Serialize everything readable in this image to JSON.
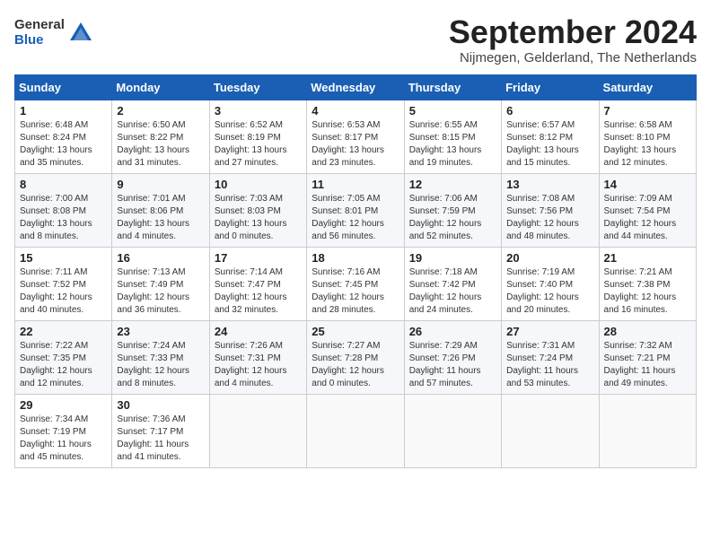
{
  "logo": {
    "general": "General",
    "blue": "Blue"
  },
  "title": "September 2024",
  "subtitle": "Nijmegen, Gelderland, The Netherlands",
  "headers": [
    "Sunday",
    "Monday",
    "Tuesday",
    "Wednesday",
    "Thursday",
    "Friday",
    "Saturday"
  ],
  "weeks": [
    [
      {
        "day": "1",
        "info": "Sunrise: 6:48 AM\nSunset: 8:24 PM\nDaylight: 13 hours\nand 35 minutes."
      },
      {
        "day": "2",
        "info": "Sunrise: 6:50 AM\nSunset: 8:22 PM\nDaylight: 13 hours\nand 31 minutes."
      },
      {
        "day": "3",
        "info": "Sunrise: 6:52 AM\nSunset: 8:19 PM\nDaylight: 13 hours\nand 27 minutes."
      },
      {
        "day": "4",
        "info": "Sunrise: 6:53 AM\nSunset: 8:17 PM\nDaylight: 13 hours\nand 23 minutes."
      },
      {
        "day": "5",
        "info": "Sunrise: 6:55 AM\nSunset: 8:15 PM\nDaylight: 13 hours\nand 19 minutes."
      },
      {
        "day": "6",
        "info": "Sunrise: 6:57 AM\nSunset: 8:12 PM\nDaylight: 13 hours\nand 15 minutes."
      },
      {
        "day": "7",
        "info": "Sunrise: 6:58 AM\nSunset: 8:10 PM\nDaylight: 13 hours\nand 12 minutes."
      }
    ],
    [
      {
        "day": "8",
        "info": "Sunrise: 7:00 AM\nSunset: 8:08 PM\nDaylight: 13 hours\nand 8 minutes."
      },
      {
        "day": "9",
        "info": "Sunrise: 7:01 AM\nSunset: 8:06 PM\nDaylight: 13 hours\nand 4 minutes."
      },
      {
        "day": "10",
        "info": "Sunrise: 7:03 AM\nSunset: 8:03 PM\nDaylight: 13 hours\nand 0 minutes."
      },
      {
        "day": "11",
        "info": "Sunrise: 7:05 AM\nSunset: 8:01 PM\nDaylight: 12 hours\nand 56 minutes."
      },
      {
        "day": "12",
        "info": "Sunrise: 7:06 AM\nSunset: 7:59 PM\nDaylight: 12 hours\nand 52 minutes."
      },
      {
        "day": "13",
        "info": "Sunrise: 7:08 AM\nSunset: 7:56 PM\nDaylight: 12 hours\nand 48 minutes."
      },
      {
        "day": "14",
        "info": "Sunrise: 7:09 AM\nSunset: 7:54 PM\nDaylight: 12 hours\nand 44 minutes."
      }
    ],
    [
      {
        "day": "15",
        "info": "Sunrise: 7:11 AM\nSunset: 7:52 PM\nDaylight: 12 hours\nand 40 minutes."
      },
      {
        "day": "16",
        "info": "Sunrise: 7:13 AM\nSunset: 7:49 PM\nDaylight: 12 hours\nand 36 minutes."
      },
      {
        "day": "17",
        "info": "Sunrise: 7:14 AM\nSunset: 7:47 PM\nDaylight: 12 hours\nand 32 minutes."
      },
      {
        "day": "18",
        "info": "Sunrise: 7:16 AM\nSunset: 7:45 PM\nDaylight: 12 hours\nand 28 minutes."
      },
      {
        "day": "19",
        "info": "Sunrise: 7:18 AM\nSunset: 7:42 PM\nDaylight: 12 hours\nand 24 minutes."
      },
      {
        "day": "20",
        "info": "Sunrise: 7:19 AM\nSunset: 7:40 PM\nDaylight: 12 hours\nand 20 minutes."
      },
      {
        "day": "21",
        "info": "Sunrise: 7:21 AM\nSunset: 7:38 PM\nDaylight: 12 hours\nand 16 minutes."
      }
    ],
    [
      {
        "day": "22",
        "info": "Sunrise: 7:22 AM\nSunset: 7:35 PM\nDaylight: 12 hours\nand 12 minutes."
      },
      {
        "day": "23",
        "info": "Sunrise: 7:24 AM\nSunset: 7:33 PM\nDaylight: 12 hours\nand 8 minutes."
      },
      {
        "day": "24",
        "info": "Sunrise: 7:26 AM\nSunset: 7:31 PM\nDaylight: 12 hours\nand 4 minutes."
      },
      {
        "day": "25",
        "info": "Sunrise: 7:27 AM\nSunset: 7:28 PM\nDaylight: 12 hours\nand 0 minutes."
      },
      {
        "day": "26",
        "info": "Sunrise: 7:29 AM\nSunset: 7:26 PM\nDaylight: 11 hours\nand 57 minutes."
      },
      {
        "day": "27",
        "info": "Sunrise: 7:31 AM\nSunset: 7:24 PM\nDaylight: 11 hours\nand 53 minutes."
      },
      {
        "day": "28",
        "info": "Sunrise: 7:32 AM\nSunset: 7:21 PM\nDaylight: 11 hours\nand 49 minutes."
      }
    ],
    [
      {
        "day": "29",
        "info": "Sunrise: 7:34 AM\nSunset: 7:19 PM\nDaylight: 11 hours\nand 45 minutes."
      },
      {
        "day": "30",
        "info": "Sunrise: 7:36 AM\nSunset: 7:17 PM\nDaylight: 11 hours\nand 41 minutes."
      },
      {
        "day": "",
        "info": ""
      },
      {
        "day": "",
        "info": ""
      },
      {
        "day": "",
        "info": ""
      },
      {
        "day": "",
        "info": ""
      },
      {
        "day": "",
        "info": ""
      }
    ]
  ]
}
